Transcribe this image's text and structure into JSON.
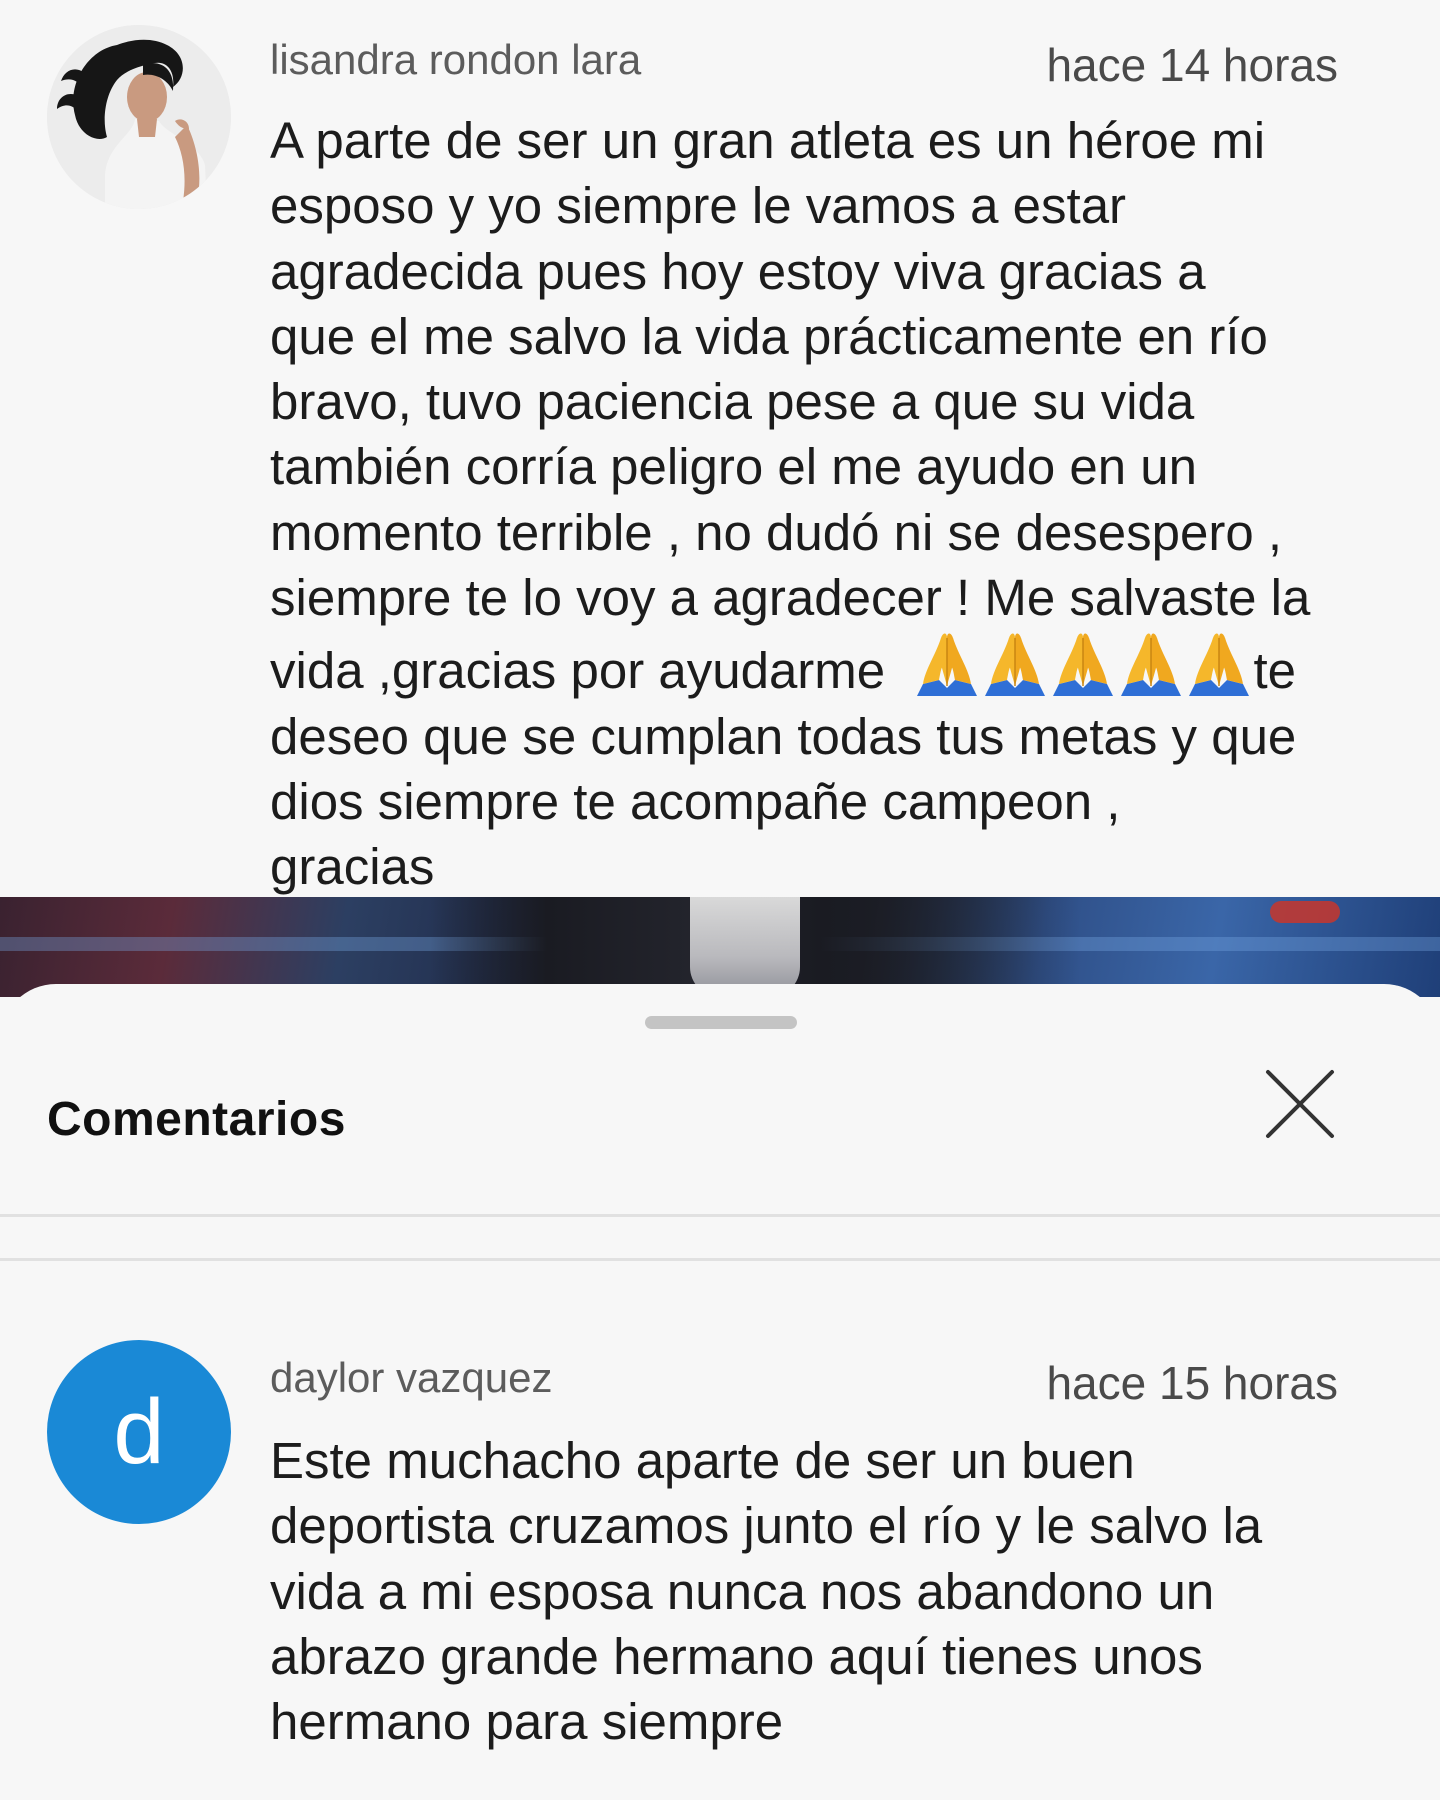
{
  "comments": [
    {
      "author": "lisandra rondon lara",
      "time": "hace 14 horas",
      "avatar_kind": "photo",
      "lines": [
        "A parte de ser un gran atleta es un héroe mi",
        "esposo y yo siempre le vamos a estar",
        "agradecida pues hoy estoy viva gracias a",
        "que el me salvo la vida prácticamente en río",
        "bravo, tuvo paciencia pese a que su vida",
        "también corría peligro el me ayudo en un",
        "momento terrible  , no dudó ni se desespero ,",
        "siempre te lo voy a agradecer ! Me salvaste la"
      ],
      "emoji_line_before": "vida ,gracias por ayudarme  ",
      "emoji": "🙏",
      "emoji_count": 5,
      "emoji_line_after": "te",
      "lines_after": [
        "deseo que se cumplan todas tus metas y que",
        "dios siempre te acompañe  campeon ,",
        "gracias"
      ]
    },
    {
      "author": "daylor vazquez",
      "time": "hace 15 horas",
      "avatar_letter": "d",
      "avatar_color": "#1a89d6",
      "lines": [
        "Este muchacho aparte de ser un buen",
        "deportista cruzamos junto el río y le salvo la",
        "vida a mi esposa nunca nos abandono un",
        "abrazo grande hermano aquí tienes unos",
        "hermano para siempre"
      ]
    }
  ],
  "sheet": {
    "title": "Comentarios",
    "close_icon": "close-icon"
  },
  "colors": {
    "background": "#f7f7f7",
    "avatar_blue": "#1a89d6",
    "divider": "#e1e1e1",
    "handle": "#c4c4c4"
  }
}
